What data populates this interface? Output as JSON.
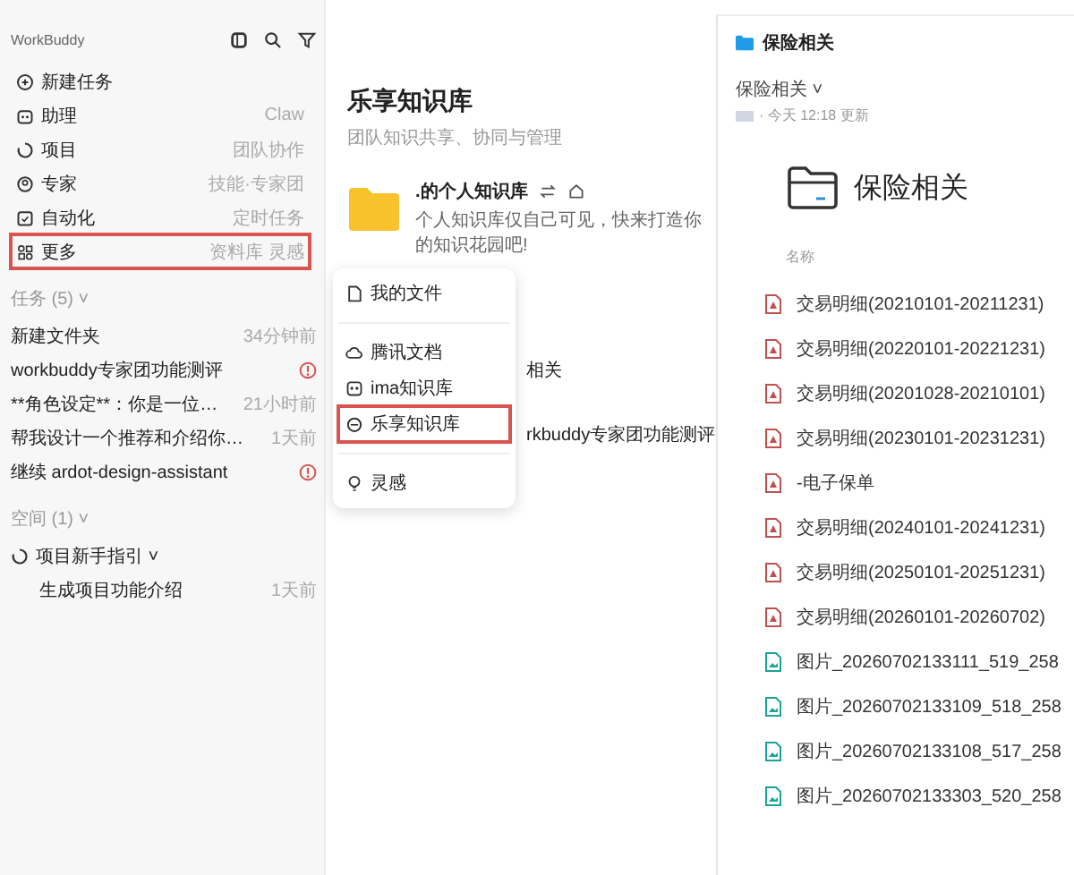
{
  "sidebar": {
    "app_name": "WorkBuddy",
    "nav": [
      {
        "label": "新建任务",
        "selected": false
      },
      {
        "label": "助理",
        "meta": "Claw",
        "selected": false
      },
      {
        "label": "项目",
        "meta": "团队协作",
        "selected": false
      },
      {
        "label": "专家",
        "meta": "技能·专家团",
        "selected": false
      },
      {
        "label": "自动化",
        "meta": "定时任务",
        "selected": false
      },
      {
        "label": "更多",
        "meta": "资料库 灵感",
        "selected": true
      }
    ],
    "tasks_header": "任务 (5) ˅",
    "tasks": [
      {
        "title": "新建文件夹",
        "meta": "34分钟前",
        "alert": false
      },
      {
        "title": "workbuddy专家团功能测评",
        "alert": true
      },
      {
        "title": "**角色设定**：你是一位…",
        "meta": "21小时前",
        "alert": false
      },
      {
        "title": "帮我设计一个推荐和介绍你…",
        "meta": "1天前",
        "alert": false
      },
      {
        "title": "继续 ardot-design-assistant",
        "alert": true
      }
    ],
    "spaces_header": "空间 (1) ˅",
    "spaces": [
      {
        "title": "项目新手指引 ˅",
        "children": [
          {
            "title": "生成项目功能介绍",
            "meta": "1天前"
          }
        ]
      }
    ]
  },
  "main": {
    "title": "乐享知识库",
    "subtitle": "团队知识共享、协同与管理",
    "personal": {
      "name": ".的个人知识库",
      "description": "个人知识库仅自己可见，快来打造你的知识花园吧!"
    },
    "rows": [
      "相关",
      "rkbuddy专家团功能测评"
    ]
  },
  "menu": {
    "sections": [
      {
        "items": [
          {
            "label": "我的文件",
            "selected": false
          }
        ]
      },
      {
        "items": [
          {
            "label": "腾讯文档",
            "selected": false
          },
          {
            "label": "ima知识库",
            "selected": false
          },
          {
            "label": "乐享知识库",
            "selected": true
          }
        ]
      },
      {
        "items": [
          {
            "label": "灵感",
            "selected": false
          }
        ]
      }
    ]
  },
  "folder": {
    "title": "保险相关",
    "breadcrumb": "保险相关 ˅",
    "updated": "· 今天 12:18 更新",
    "heading": "保险相关",
    "column": "名称",
    "files": [
      {
        "kind": "pdf",
        "name": "交易明细(20210101-20211231)"
      },
      {
        "kind": "pdf",
        "name": "交易明细(20220101-20221231)"
      },
      {
        "kind": "pdf",
        "name": "交易明细(20201028-20210101)"
      },
      {
        "kind": "pdf",
        "name": "交易明细(20230101-20231231)"
      },
      {
        "kind": "pdf",
        "name": "-电子保单"
      },
      {
        "kind": "pdf",
        "name": "交易明细(20240101-20241231)"
      },
      {
        "kind": "pdf",
        "name": "交易明细(20250101-20251231)"
      },
      {
        "kind": "pdf",
        "name": "交易明细(20260101-20260702)"
      },
      {
        "kind": "image",
        "name": "图片_20260702133111_519_258"
      },
      {
        "kind": "image",
        "name": "图片_20260702133109_518_258"
      },
      {
        "kind": "image",
        "name": "图片_20260702133108_517_258"
      },
      {
        "kind": "image",
        "name": "图片_20260702133303_520_258"
      }
    ]
  }
}
